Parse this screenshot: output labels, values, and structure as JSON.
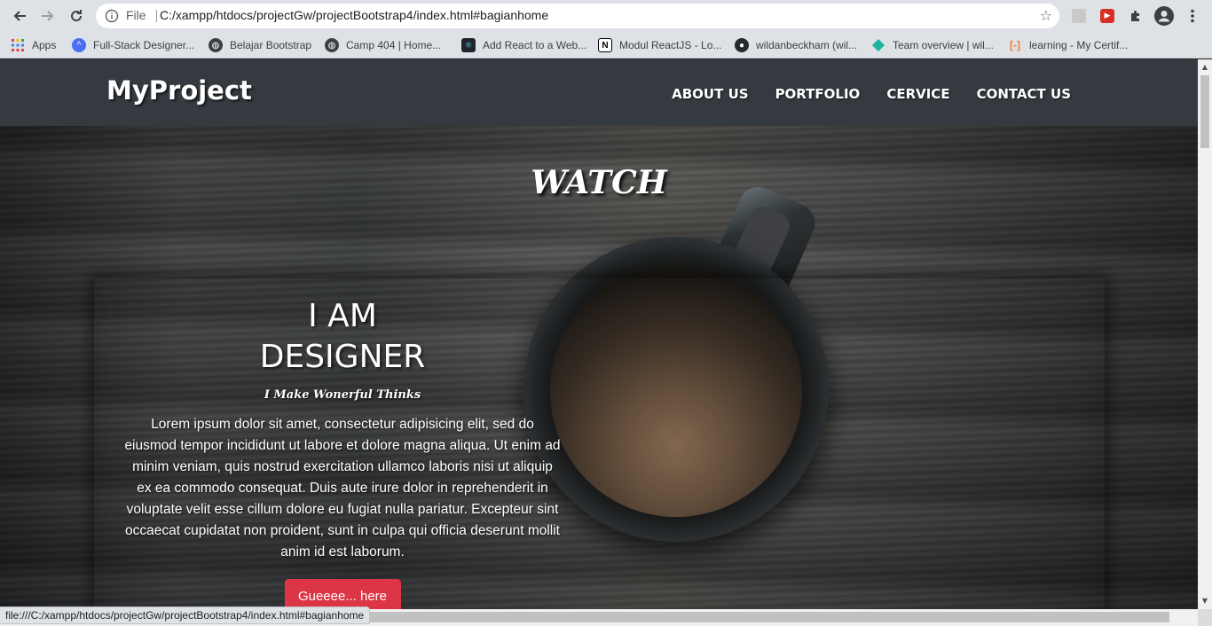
{
  "browser": {
    "file_label": "File",
    "url": "C:/xampp/htdocs/projectGw/projectBootstrap4/index.html#bagianhome",
    "status_url": "file:///C:/xampp/htdocs/projectGw/projectBootstrap4/index.html#bagianhome",
    "bookmarks": [
      {
        "label": "Apps",
        "icon": "apps-grid-icon",
        "color": "#4285f4"
      },
      {
        "label": "Full-Stack Designer...",
        "icon": "circle-icon",
        "color": "#4c6ef5"
      },
      {
        "label": "Belajar Bootstrap",
        "icon": "globe-icon",
        "color": "#3c4043"
      },
      {
        "label": "Camp 404 | Home...",
        "icon": "globe-icon",
        "color": "#3c4043"
      },
      {
        "label": "Add React to a Web...",
        "icon": "react-icon",
        "color": "#20232a"
      },
      {
        "label": "Modul ReactJS - Lo...",
        "icon": "notion-icon",
        "color": "#000000"
      },
      {
        "label": "wildanbeckham (wil...",
        "icon": "github-icon",
        "color": "#24292e"
      },
      {
        "label": "Team overview | wil...",
        "icon": "diamond-icon",
        "color": "#1db3a0"
      },
      {
        "label": "learning - My Certif...",
        "icon": "bracket-icon",
        "color": "#f0803c"
      }
    ]
  },
  "page": {
    "brand": "MyProject",
    "nav": [
      "ABOUT US",
      "PORTFOLIO",
      "CERVICE",
      "CONTACT US"
    ],
    "hero_heading": "WATCH",
    "title": "I AM DESIGNER",
    "subtitle": "I Make Wonerful Thinks",
    "body": "Lorem ipsum dolor sit amet, consectetur adipisicing elit, sed do eiusmod tempor incididunt ut labore et dolore magna aliqua. Ut enim ad minim veniam, quis nostrud exercitation ullamco laboris nisi ut aliquip ex ea commodo consequat. Duis aute irure dolor in reprehenderit in voluptate velit esse cillum dolore eu fugiat nulla pariatur. Excepteur sint occaecat cupidatat non proident, sunt in culpa qui officia deserunt mollit anim id est laborum.",
    "button": "Gueeee... here",
    "accent": "#dc3545",
    "navbar_color": "#343a40"
  }
}
